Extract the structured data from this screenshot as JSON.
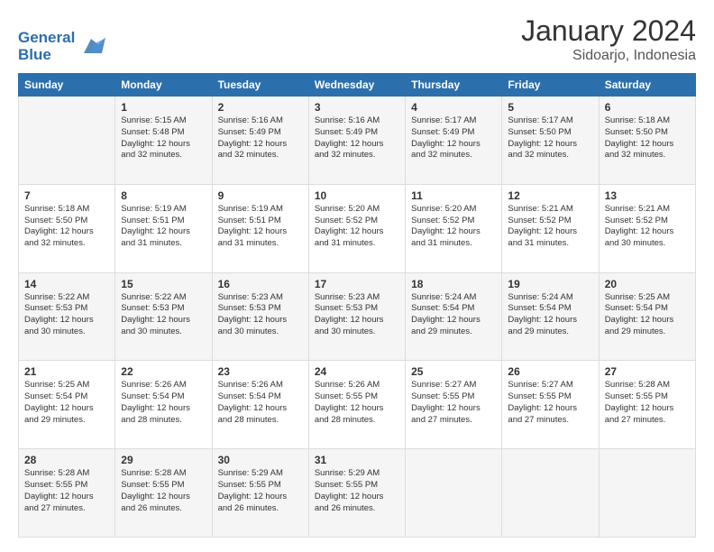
{
  "header": {
    "logo_line1": "General",
    "logo_line2": "Blue",
    "title": "January 2024",
    "subtitle": "Sidoarjo, Indonesia"
  },
  "days_of_week": [
    "Sunday",
    "Monday",
    "Tuesday",
    "Wednesday",
    "Thursday",
    "Friday",
    "Saturday"
  ],
  "weeks": [
    [
      {
        "day": "",
        "info": ""
      },
      {
        "day": "1",
        "info": "Sunrise: 5:15 AM\nSunset: 5:48 PM\nDaylight: 12 hours\nand 32 minutes."
      },
      {
        "day": "2",
        "info": "Sunrise: 5:16 AM\nSunset: 5:49 PM\nDaylight: 12 hours\nand 32 minutes."
      },
      {
        "day": "3",
        "info": "Sunrise: 5:16 AM\nSunset: 5:49 PM\nDaylight: 12 hours\nand 32 minutes."
      },
      {
        "day": "4",
        "info": "Sunrise: 5:17 AM\nSunset: 5:49 PM\nDaylight: 12 hours\nand 32 minutes."
      },
      {
        "day": "5",
        "info": "Sunrise: 5:17 AM\nSunset: 5:50 PM\nDaylight: 12 hours\nand 32 minutes."
      },
      {
        "day": "6",
        "info": "Sunrise: 5:18 AM\nSunset: 5:50 PM\nDaylight: 12 hours\nand 32 minutes."
      }
    ],
    [
      {
        "day": "7",
        "info": "Sunrise: 5:18 AM\nSunset: 5:50 PM\nDaylight: 12 hours\nand 32 minutes."
      },
      {
        "day": "8",
        "info": "Sunrise: 5:19 AM\nSunset: 5:51 PM\nDaylight: 12 hours\nand 31 minutes."
      },
      {
        "day": "9",
        "info": "Sunrise: 5:19 AM\nSunset: 5:51 PM\nDaylight: 12 hours\nand 31 minutes."
      },
      {
        "day": "10",
        "info": "Sunrise: 5:20 AM\nSunset: 5:52 PM\nDaylight: 12 hours\nand 31 minutes."
      },
      {
        "day": "11",
        "info": "Sunrise: 5:20 AM\nSunset: 5:52 PM\nDaylight: 12 hours\nand 31 minutes."
      },
      {
        "day": "12",
        "info": "Sunrise: 5:21 AM\nSunset: 5:52 PM\nDaylight: 12 hours\nand 31 minutes."
      },
      {
        "day": "13",
        "info": "Sunrise: 5:21 AM\nSunset: 5:52 PM\nDaylight: 12 hours\nand 30 minutes."
      }
    ],
    [
      {
        "day": "14",
        "info": "Sunrise: 5:22 AM\nSunset: 5:53 PM\nDaylight: 12 hours\nand 30 minutes."
      },
      {
        "day": "15",
        "info": "Sunrise: 5:22 AM\nSunset: 5:53 PM\nDaylight: 12 hours\nand 30 minutes."
      },
      {
        "day": "16",
        "info": "Sunrise: 5:23 AM\nSunset: 5:53 PM\nDaylight: 12 hours\nand 30 minutes."
      },
      {
        "day": "17",
        "info": "Sunrise: 5:23 AM\nSunset: 5:53 PM\nDaylight: 12 hours\nand 30 minutes."
      },
      {
        "day": "18",
        "info": "Sunrise: 5:24 AM\nSunset: 5:54 PM\nDaylight: 12 hours\nand 29 minutes."
      },
      {
        "day": "19",
        "info": "Sunrise: 5:24 AM\nSunset: 5:54 PM\nDaylight: 12 hours\nand 29 minutes."
      },
      {
        "day": "20",
        "info": "Sunrise: 5:25 AM\nSunset: 5:54 PM\nDaylight: 12 hours\nand 29 minutes."
      }
    ],
    [
      {
        "day": "21",
        "info": "Sunrise: 5:25 AM\nSunset: 5:54 PM\nDaylight: 12 hours\nand 29 minutes."
      },
      {
        "day": "22",
        "info": "Sunrise: 5:26 AM\nSunset: 5:54 PM\nDaylight: 12 hours\nand 28 minutes."
      },
      {
        "day": "23",
        "info": "Sunrise: 5:26 AM\nSunset: 5:54 PM\nDaylight: 12 hours\nand 28 minutes."
      },
      {
        "day": "24",
        "info": "Sunrise: 5:26 AM\nSunset: 5:55 PM\nDaylight: 12 hours\nand 28 minutes."
      },
      {
        "day": "25",
        "info": "Sunrise: 5:27 AM\nSunset: 5:55 PM\nDaylight: 12 hours\nand 27 minutes."
      },
      {
        "day": "26",
        "info": "Sunrise: 5:27 AM\nSunset: 5:55 PM\nDaylight: 12 hours\nand 27 minutes."
      },
      {
        "day": "27",
        "info": "Sunrise: 5:28 AM\nSunset: 5:55 PM\nDaylight: 12 hours\nand 27 minutes."
      }
    ],
    [
      {
        "day": "28",
        "info": "Sunrise: 5:28 AM\nSunset: 5:55 PM\nDaylight: 12 hours\nand 27 minutes."
      },
      {
        "day": "29",
        "info": "Sunrise: 5:28 AM\nSunset: 5:55 PM\nDaylight: 12 hours\nand 26 minutes."
      },
      {
        "day": "30",
        "info": "Sunrise: 5:29 AM\nSunset: 5:55 PM\nDaylight: 12 hours\nand 26 minutes."
      },
      {
        "day": "31",
        "info": "Sunrise: 5:29 AM\nSunset: 5:55 PM\nDaylight: 12 hours\nand 26 minutes."
      },
      {
        "day": "",
        "info": ""
      },
      {
        "day": "",
        "info": ""
      },
      {
        "day": "",
        "info": ""
      }
    ]
  ]
}
